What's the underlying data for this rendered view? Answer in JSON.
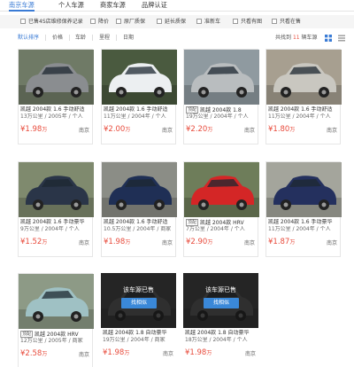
{
  "tabs": [
    {
      "label": "南京车源"
    },
    {
      "label": "个人车源"
    },
    {
      "label": "商家车源"
    },
    {
      "label": "品牌认证"
    }
  ],
  "filters": [
    {
      "label": "已售4S店维修保养记录"
    },
    {
      "label": "降价"
    },
    {
      "label": "原厂质保"
    },
    {
      "label": "延长质保"
    },
    {
      "label": "准新车"
    },
    {
      "label": "只看有图"
    },
    {
      "label": "只看在售"
    }
  ],
  "sort": {
    "items": [
      {
        "label": "默认排序"
      },
      {
        "label": "价格"
      },
      {
        "label": "车龄"
      },
      {
        "label": "里程"
      },
      {
        "label": "日期"
      }
    ],
    "total_prefix": "共找到",
    "total_count": "11",
    "total_suffix": "辆车源"
  },
  "sold_label": "该车源已售",
  "find_similar_label": "找相似",
  "cards": [
    {
      "title": "凯越 2004款 1.6 手动舒适",
      "sub": "13万公里 / 2005年 / 个人",
      "price": "1.98",
      "unit": "万",
      "city": "南京",
      "badge": "",
      "sold": false,
      "car_color": "#8a8d90",
      "bg": "#6f7a66"
    },
    {
      "title": "凯越 2004款 1.6 手动舒适",
      "sub": "11万公里 / 2004年 / 个人",
      "price": "2.00",
      "unit": "万",
      "city": "南京",
      "badge": "",
      "sold": false,
      "car_color": "#eceff1",
      "bg": "#4a5a3f"
    },
    {
      "title": "凯越 2004款 1.8",
      "sub": "19万公里 / 2004年 / 个人",
      "price": "2.20",
      "unit": "万",
      "city": "南京",
      "badge": "顶配",
      "sold": false,
      "car_color": "#b9bdbf",
      "bg": "#8f9aa0"
    },
    {
      "title": "凯越 2004款 1.6 手动舒适",
      "sub": "11万公里 / 2004年 / 个人",
      "price": "1.80",
      "unit": "万",
      "city": "南京",
      "badge": "",
      "sold": false,
      "car_color": "#c9c7c0",
      "bg": "#a79f90"
    },
    {
      "title": "凯越 2004款 1.6 手动豪华",
      "sub": "9万公里 / 2004年 / 个人",
      "price": "1.52",
      "unit": "万",
      "city": "南京",
      "badge": "",
      "sold": false,
      "car_color": "#2a3548",
      "bg": "#7f8a6e"
    },
    {
      "title": "凯越 2004款 1.6 手动舒适",
      "sub": "10.5万公里 / 2004年 / 商家",
      "price": "1.98",
      "unit": "万",
      "city": "南京",
      "badge": "",
      "sold": false,
      "car_color": "#1f2f55",
      "bg": "#8b8d86"
    },
    {
      "title": "凯越 2004款 HRV",
      "sub": "7万公里 / 2004年 / 个人",
      "price": "2.90",
      "unit": "万",
      "city": "南京",
      "badge": "顶配",
      "sold": false,
      "car_color": "#d42626",
      "bg": "#6e7d5a"
    },
    {
      "title": "凯越 2004款 1.6 手动豪华",
      "sub": "11万公里 / 2004年 / 个人",
      "price": "1.87",
      "unit": "万",
      "city": "南京",
      "badge": "",
      "sold": false,
      "car_color": "#24305e",
      "bg": "#a4a59c"
    },
    {
      "title": "凯越 2004款 HRV",
      "sub": "12万公里 / 2005年 / 商家",
      "price": "2.58",
      "unit": "万",
      "city": "南京",
      "badge": "顶配",
      "sold": false,
      "car_color": "#9fc1c4",
      "bg": "#8d9a86"
    },
    {
      "title": "凯越 2004款 1.8 自动豪华",
      "sub": "19万公里 / 2004年 / 商家",
      "price": "1.98",
      "unit": "万",
      "city": "南京",
      "badge": "",
      "sold": true,
      "car_color": "#777",
      "bg": "#555"
    },
    {
      "title": "凯越 2004款 1.8 自动豪华",
      "sub": "18万公里 / 2004年 / 个人",
      "price": "1.98",
      "unit": "万",
      "city": "南京",
      "badge": "",
      "sold": true,
      "car_color": "#777",
      "bg": "#555"
    }
  ]
}
